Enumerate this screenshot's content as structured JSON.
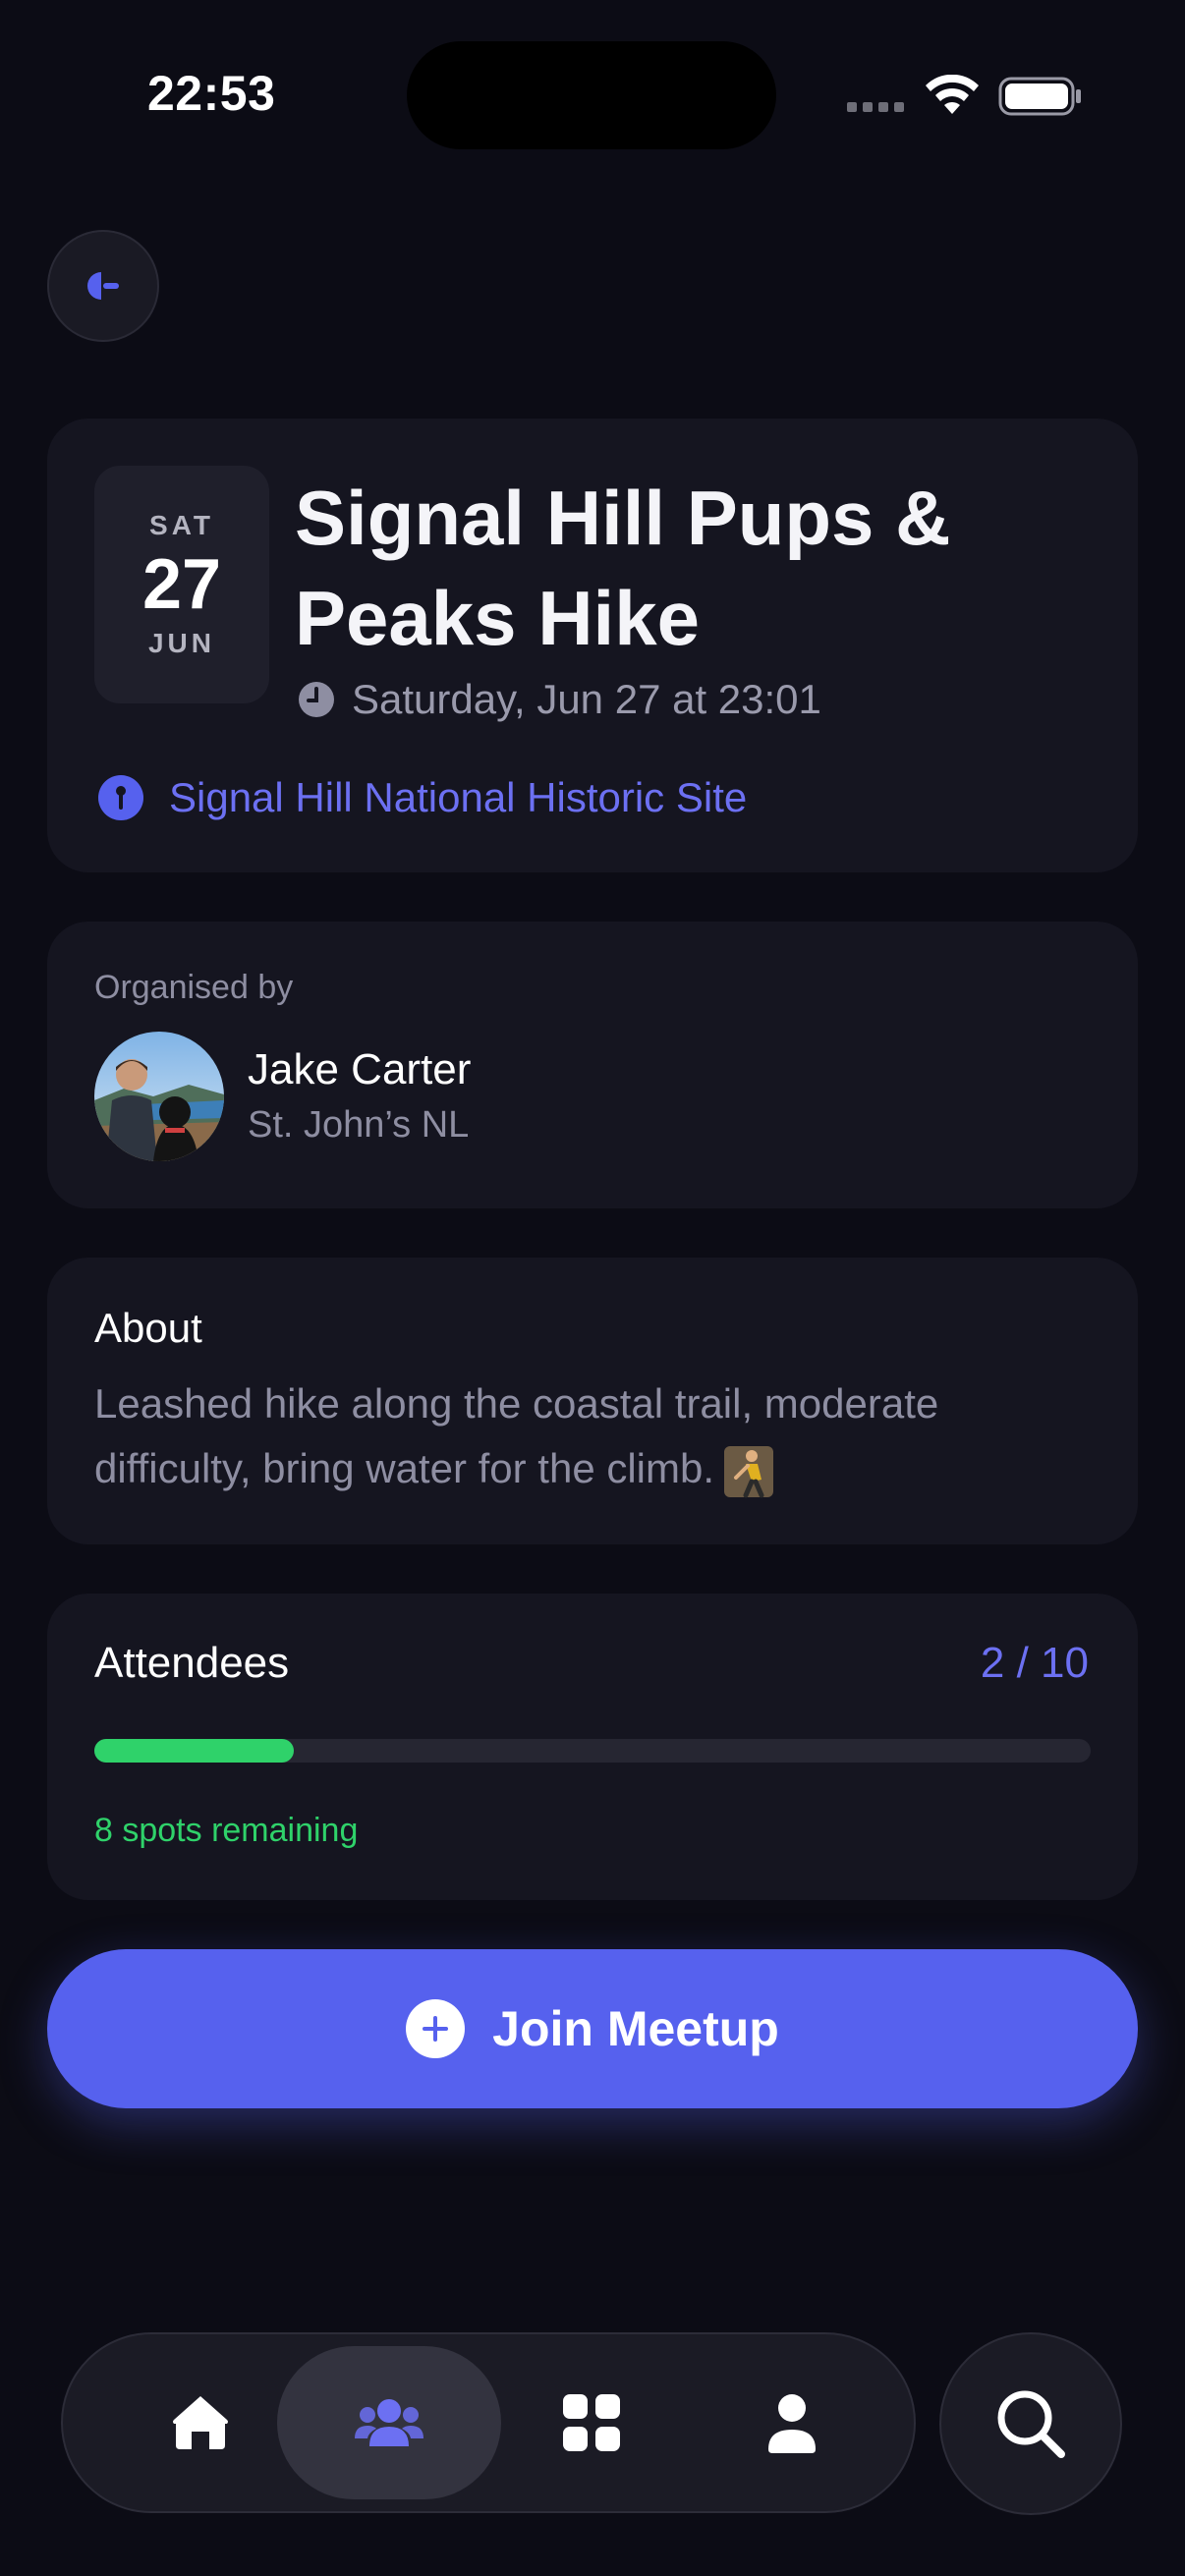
{
  "status_bar": {
    "time": "22:53"
  },
  "event": {
    "date": {
      "weekday": "SAT",
      "day": "27",
      "month": "JUN"
    },
    "title": "Signal Hill Pups & Peaks Hike",
    "when": "Saturday, Jun 27 at 23:01",
    "location": "Signal Hill National Historic Site"
  },
  "organiser": {
    "heading": "Organised by",
    "name": "Jake Carter",
    "location": "St. John’s NL"
  },
  "about": {
    "heading": "About",
    "text": "Leashed hike along the coastal trail, moderate difficulty, bring water for the climb."
  },
  "attendees": {
    "heading": "Attendees",
    "count_label": "2 / 10",
    "current": 2,
    "capacity": 10,
    "remaining_label": "8 spots remaining"
  },
  "actions": {
    "join_label": "Join Meetup"
  },
  "tab_bar": {
    "items": [
      {
        "icon": "home-icon",
        "active": false
      },
      {
        "icon": "people-icon",
        "active": true
      },
      {
        "icon": "grid-icon",
        "active": false
      },
      {
        "icon": "person-icon",
        "active": false
      }
    ],
    "search_icon": "search-icon"
  },
  "colors": {
    "background": "#0c0c15",
    "card": "#151520",
    "accent": "#5661ee",
    "link": "#6c70f2",
    "success": "#2fd26a",
    "muted_text": "#8e8ea2"
  }
}
